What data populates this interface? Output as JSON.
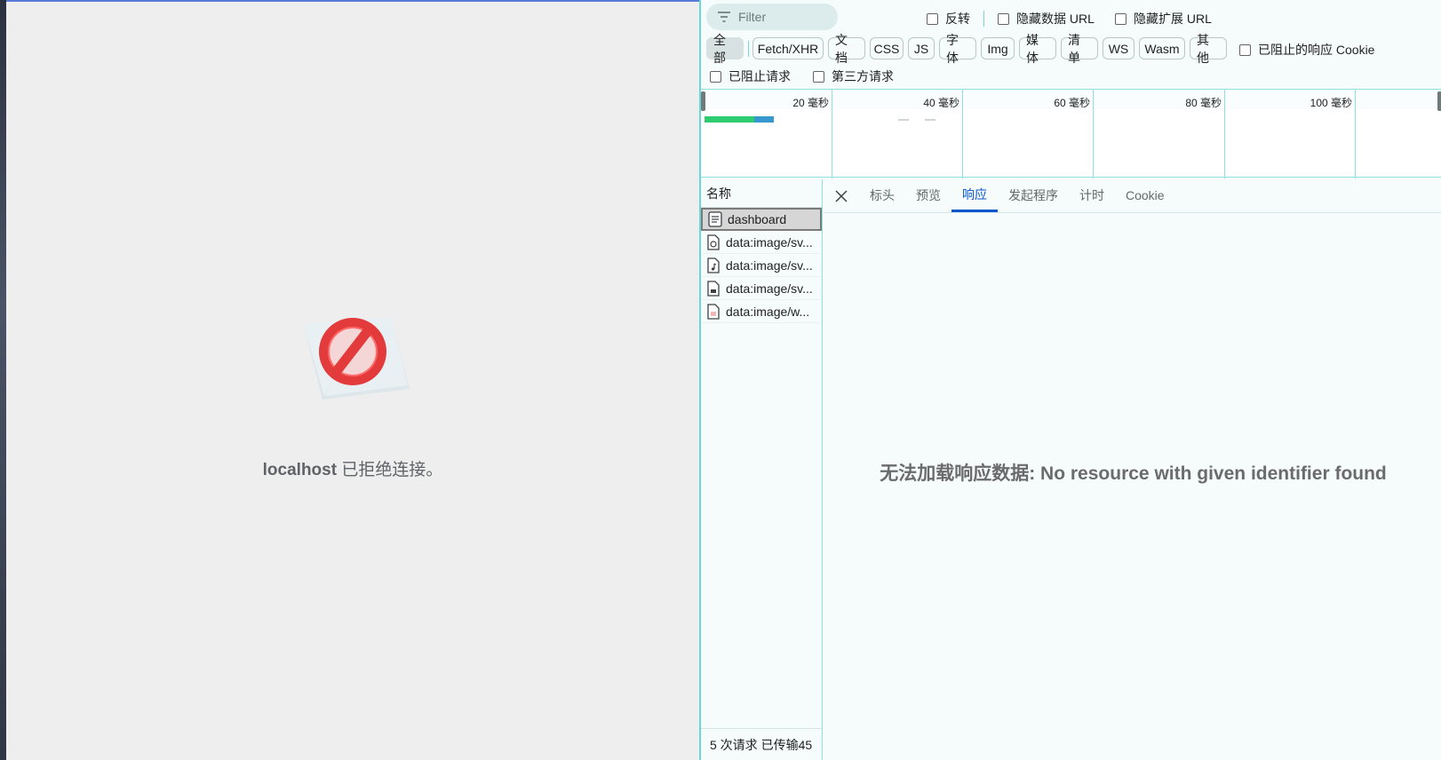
{
  "page": {
    "error_host": "localhost",
    "error_message": "已拒绝连接。"
  },
  "devtools": {
    "filter_placeholder": "Filter",
    "checkboxes_row1": [
      "反转",
      "隐藏数据 URL",
      "隐藏扩展 URL"
    ],
    "type_filters": [
      "全部",
      "Fetch/XHR",
      "文档",
      "CSS",
      "JS",
      "字体",
      "Img",
      "媒体",
      "清单",
      "WS",
      "Wasm",
      "其他"
    ],
    "blocked_cookies_label": "已阻止的响应 Cookie",
    "checkboxes_row3": [
      "已阻止请求",
      "第三方请求"
    ],
    "overview_ticks": [
      "20 毫秒",
      "40 毫秒",
      "60 毫秒",
      "80 毫秒",
      "100 毫秒"
    ],
    "request_list": {
      "header": "名称",
      "items": [
        {
          "name": "dashboard",
          "icon": "document-icon"
        },
        {
          "name": "data:image/sv...",
          "icon": "svg-file-icon"
        },
        {
          "name": "data:image/sv...",
          "icon": "audio-file-icon"
        },
        {
          "name": "data:image/sv...",
          "icon": "image-file-icon"
        },
        {
          "name": "data:image/w...",
          "icon": "webp-file-icon"
        }
      ],
      "status": "5 次请求  已传输45"
    },
    "detail": {
      "tabs": [
        "标头",
        "预览",
        "响应",
        "发起程序",
        "计时",
        "Cookie"
      ],
      "active_tab": "响应",
      "message": "无法加载响应数据: No resource with given identifier found"
    },
    "colors": {
      "accent": "#0b57d0",
      "border": "#8fe0e0",
      "bar_green": "#2ecc71",
      "bar_blue": "#3b82f6"
    }
  }
}
